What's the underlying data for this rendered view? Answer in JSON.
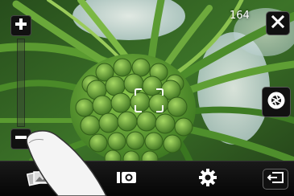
{
  "camera": {
    "shots_remaining": "164",
    "zoom_level": 0.0
  },
  "icons": {
    "zoom_in": "plus-icon",
    "zoom_out": "minus-icon",
    "close": "close-icon",
    "shutter": "camera-aperture-icon",
    "focus": "focus-frame-icon",
    "gallery": "gallery-icon",
    "camcorder": "camcorder-icon",
    "settings": "gear-icon",
    "back": "back-icon"
  },
  "colors": {
    "foliage": "#3f7f2a",
    "fruit": "#6fb23a",
    "sky": "#e8f2f6"
  }
}
